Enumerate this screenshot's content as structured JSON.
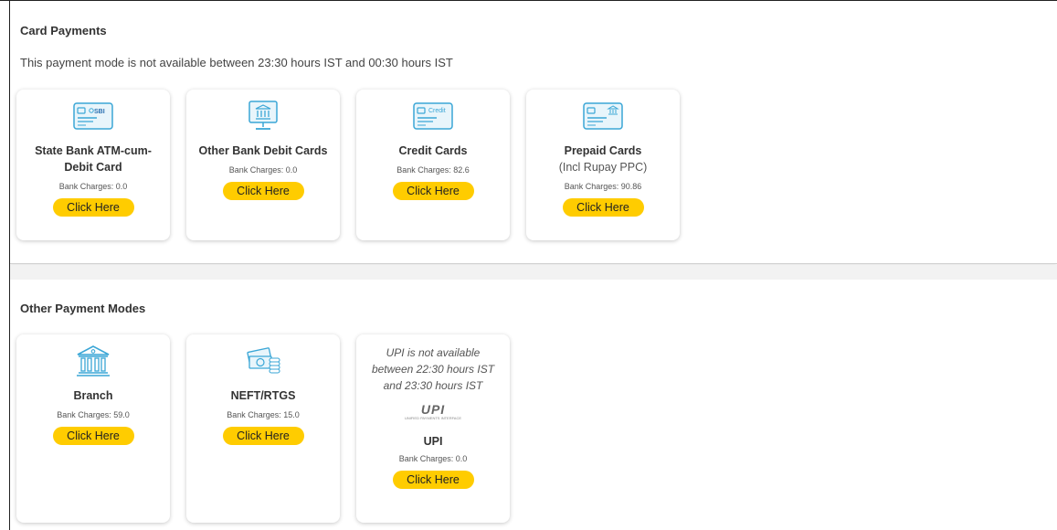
{
  "card_section": {
    "title": "Card Payments",
    "notice": "This payment mode is not available between 23:30 hours IST and 00:30 hours IST",
    "tiles": [
      {
        "name": "State Bank ATM-cum-Debit Card",
        "charges": "Bank Charges: 0.0",
        "button": "Click Here",
        "icon": "sbi-card-icon",
        "icon_text": "SBI"
      },
      {
        "name": "Other Bank Debit Cards",
        "charges": "Bank Charges: 0.0",
        "button": "Click Here",
        "icon": "bank-monitor-icon"
      },
      {
        "name": "Credit Cards",
        "charges": "Bank Charges: 82.6",
        "button": "Click Here",
        "icon": "credit-card-icon",
        "icon_text": "Credit"
      },
      {
        "name": "Prepaid Cards",
        "subtitle": "(Incl Rupay PPC)",
        "charges": "Bank Charges: 90.86",
        "button": "Click Here",
        "icon": "prepaid-card-icon"
      }
    ]
  },
  "other_section": {
    "title": "Other Payment Modes",
    "tiles": [
      {
        "name": "Branch",
        "charges": "Bank Charges: 59.0",
        "button": "Click Here",
        "icon": "bank-building-icon"
      },
      {
        "name": "NEFT/RTGS",
        "charges": "Bank Charges: 15.0",
        "button": "Click Here",
        "icon": "cash-coins-icon"
      },
      {
        "name": "UPI",
        "note": "UPI is not available between 22:30 hours IST and 23:30 hours IST",
        "logo_text": "UPI",
        "logo_subtext": "UNIFIED PAYMENTS INTERFACE",
        "charges": "Bank Charges: 0.0",
        "button": "Click Here",
        "icon": "upi-logo"
      }
    ]
  },
  "colors": {
    "accent": "#ffcc00",
    "icon": "#3aa6d6",
    "text": "#333333",
    "separator": "#f2f2f2"
  }
}
